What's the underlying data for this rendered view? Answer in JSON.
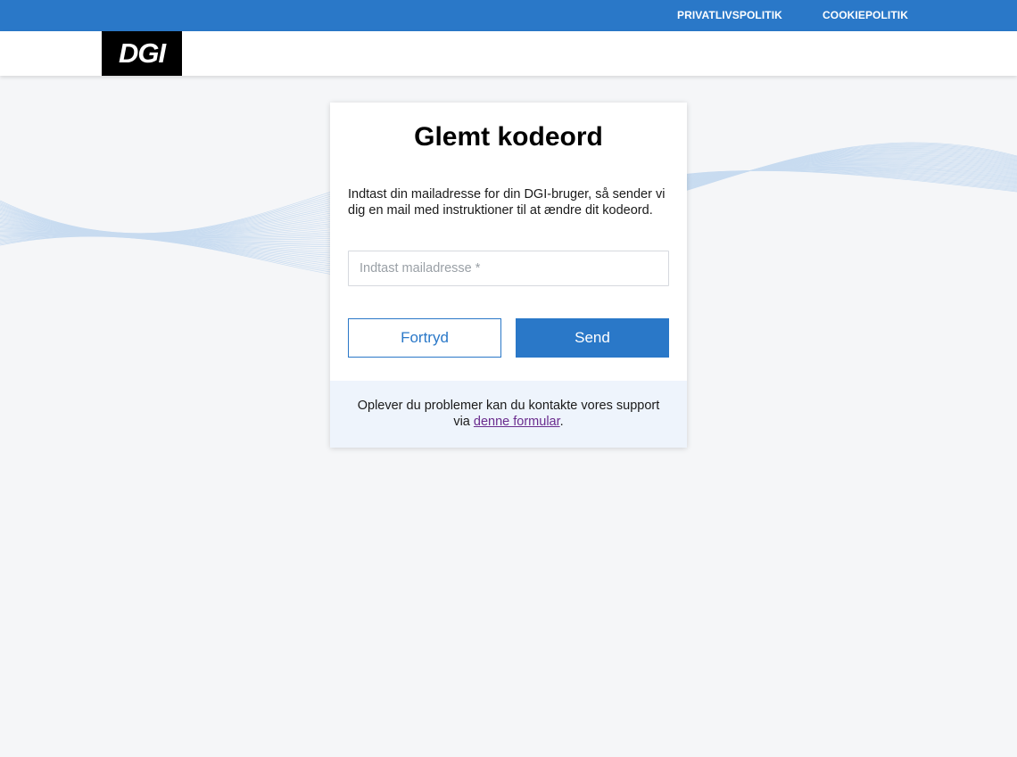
{
  "topbar": {
    "links": [
      "PRIVATLIVSPOLITIK",
      "COOKIEPOLITIK"
    ]
  },
  "logo": {
    "text": "DGI"
  },
  "card": {
    "title": "Glemt kodeord",
    "description": "Indtast din mailadresse for din DGI-bruger, så sender vi dig en mail med instruktioner til at ændre dit kodeord.",
    "email": {
      "placeholder": "Indtast mailadresse *",
      "value": ""
    },
    "cancel_label": "Fortryd",
    "send_label": "Send"
  },
  "support": {
    "prefix": "Oplever du problemer kan du kontakte vores support via ",
    "link_text": "denne formular",
    "suffix": "."
  },
  "colors": {
    "brand_blue": "#2a78c8",
    "background": "#f5f6f8",
    "support_bg": "#eef4fc",
    "link_visited": "#6a2c8e"
  }
}
